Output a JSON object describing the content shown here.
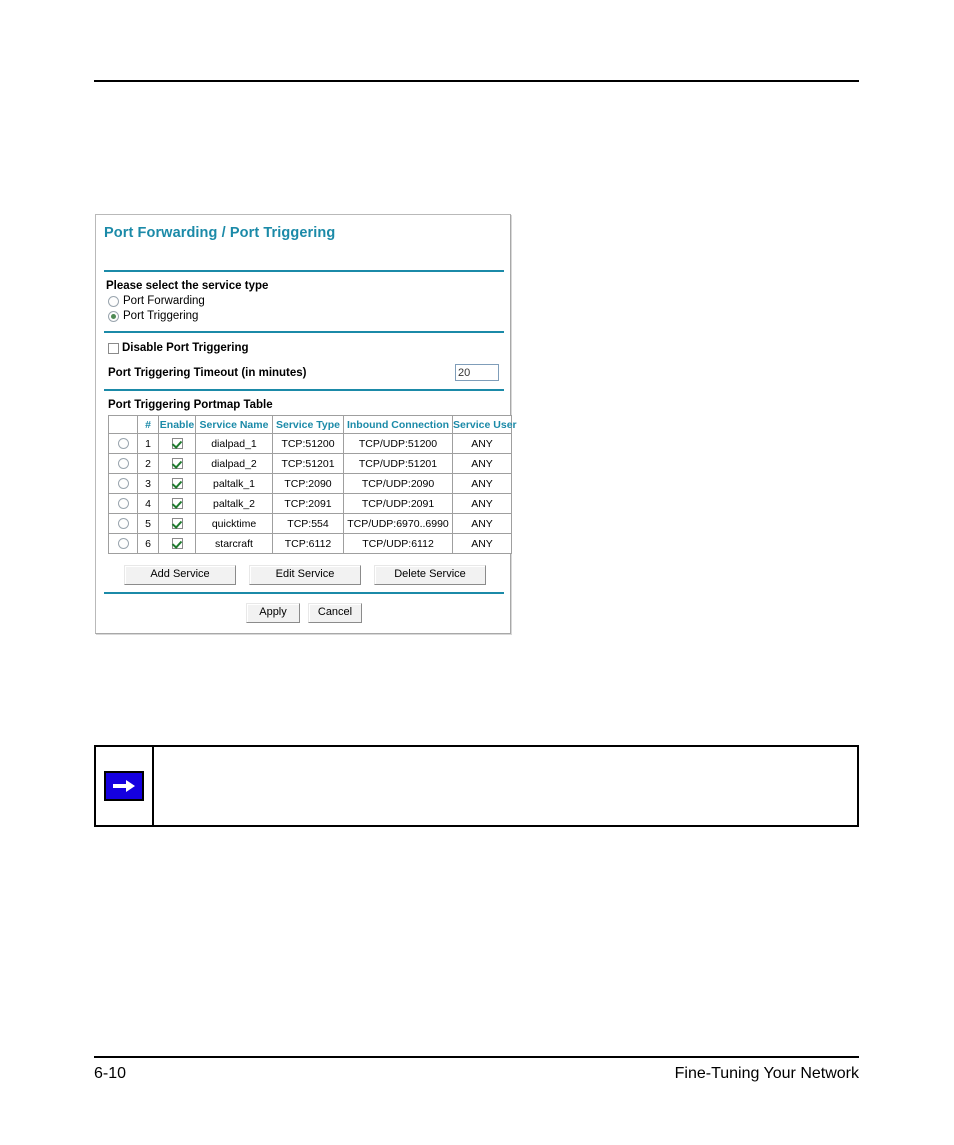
{
  "document": {
    "footer_page_number": "6-10",
    "footer_chapter": "Fine-Tuning Your Network"
  },
  "panel": {
    "title": "Port Forwarding / Port Triggering",
    "service_type": {
      "prompt": "Please select the service type",
      "options": [
        {
          "label": "Port Forwarding",
          "selected": false
        },
        {
          "label": "Port Triggering",
          "selected": true
        }
      ]
    },
    "disable_checkbox": {
      "label": "Disable Port Triggering",
      "checked": false
    },
    "timeout": {
      "label_bold": "Port Triggering Timeout",
      "label_normal": "(in minutes)",
      "value": "20"
    },
    "table": {
      "caption": "Port Triggering Portmap Table",
      "columns": [
        "",
        "#",
        "Enable",
        "Service Name",
        "Service Type",
        "Inbound Connection",
        "Service User"
      ],
      "rows": [
        {
          "num": "1",
          "enabled": true,
          "name": "dialpad_1",
          "type": "TCP:51200",
          "inbound": "TCP/UDP:51200",
          "user": "ANY"
        },
        {
          "num": "2",
          "enabled": true,
          "name": "dialpad_2",
          "type": "TCP:51201",
          "inbound": "TCP/UDP:51201",
          "user": "ANY"
        },
        {
          "num": "3",
          "enabled": true,
          "name": "paltalk_1",
          "type": "TCP:2090",
          "inbound": "TCP/UDP:2090",
          "user": "ANY"
        },
        {
          "num": "4",
          "enabled": true,
          "name": "paltalk_2",
          "type": "TCP:2091",
          "inbound": "TCP/UDP:2091",
          "user": "ANY"
        },
        {
          "num": "5",
          "enabled": true,
          "name": "quicktime",
          "type": "TCP:554",
          "inbound": "TCP/UDP:6970..6990",
          "user": "ANY"
        },
        {
          "num": "6",
          "enabled": true,
          "name": "starcraft",
          "type": "TCP:6112",
          "inbound": "TCP/UDP:6112",
          "user": "ANY"
        }
      ]
    },
    "service_buttons": [
      {
        "label": "Add Service"
      },
      {
        "label": "Edit Service"
      },
      {
        "label": "Delete Service"
      }
    ],
    "form_buttons": [
      {
        "label": "Apply"
      },
      {
        "label": "Cancel"
      }
    ]
  },
  "note": {
    "icon": "note-arrow-icon",
    "text": ""
  },
  "colors": {
    "accent_teal": "#1b8aa8",
    "note_blue": "#1500e0",
    "check_green": "#1f7a2e",
    "radio_green": "#4f8a54"
  }
}
